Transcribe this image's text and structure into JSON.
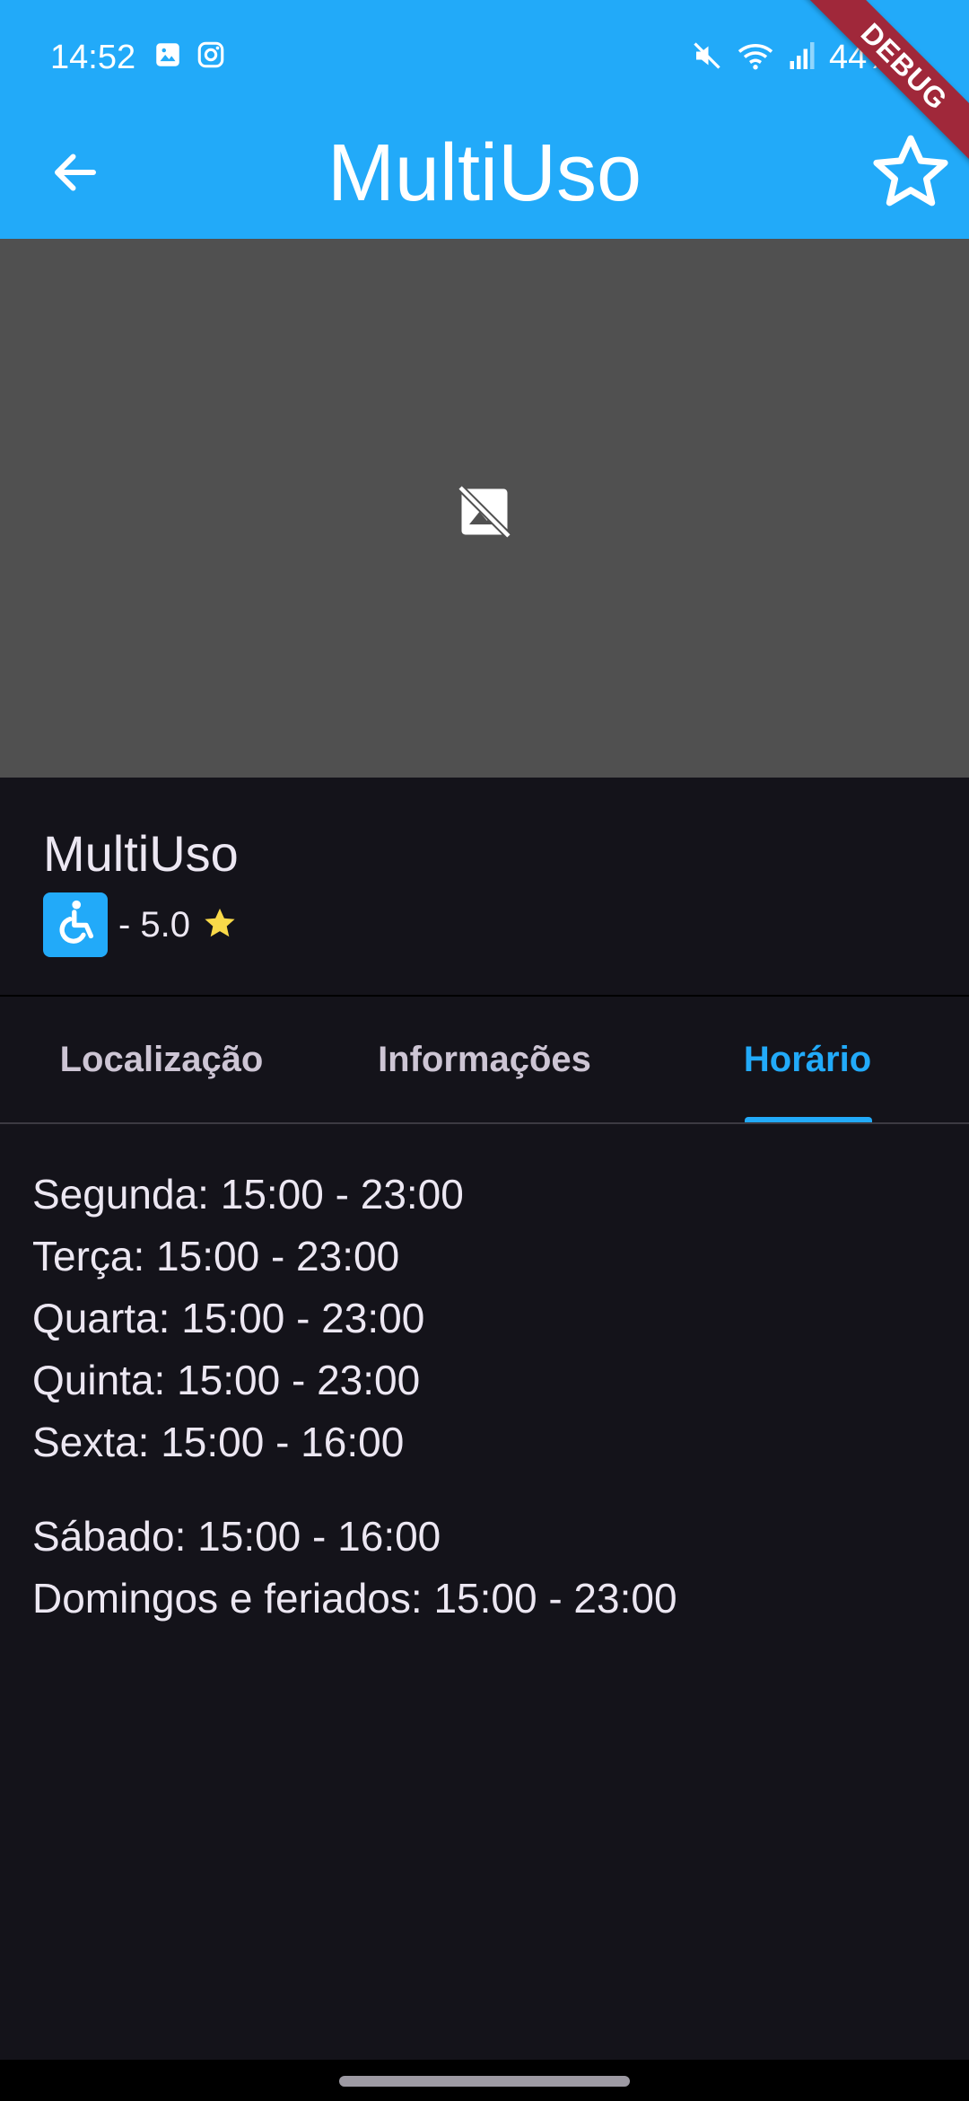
{
  "status_bar": {
    "time": "14:52",
    "battery": "44%",
    "left_icons": [
      "gallery-icon",
      "instagram-icon"
    ],
    "right_icons": [
      "mute-icon",
      "wifi-icon",
      "signal-icon"
    ]
  },
  "app_bar": {
    "title": "MultiUso",
    "back_icon": "arrow-left-icon",
    "favorite_icon": "star-outline-icon"
  },
  "debug_banner": "DEBUG",
  "hero": {
    "placeholder_icon": "image-not-supported-icon"
  },
  "venue": {
    "name": "MultiUso",
    "accessibility_icon": "wheelchair-icon",
    "rating_text": "- 5.0",
    "rating_icon": "star-filled-icon"
  },
  "tabs": [
    {
      "label": "Localização",
      "active": false
    },
    {
      "label": "Informações",
      "active": false
    },
    {
      "label": "Horário",
      "active": true
    }
  ],
  "schedule": {
    "weekdays": [
      "Segunda: 15:00 - 23:00",
      "Terça: 15:00 - 23:00",
      "Quarta: 15:00 - 23:00",
      "Quinta: 15:00 - 23:00",
      "Sexta: 15:00 - 16:00"
    ],
    "weekend": [
      "Sábado: 15:00 - 16:00",
      "Domingos e feriados: 15:00 - 23:00"
    ]
  },
  "colors": {
    "primary": "#22aaf9",
    "background": "#14131a",
    "placeholder": "#505050",
    "rating_star": "#f9d949",
    "debug": "#a0283a"
  }
}
